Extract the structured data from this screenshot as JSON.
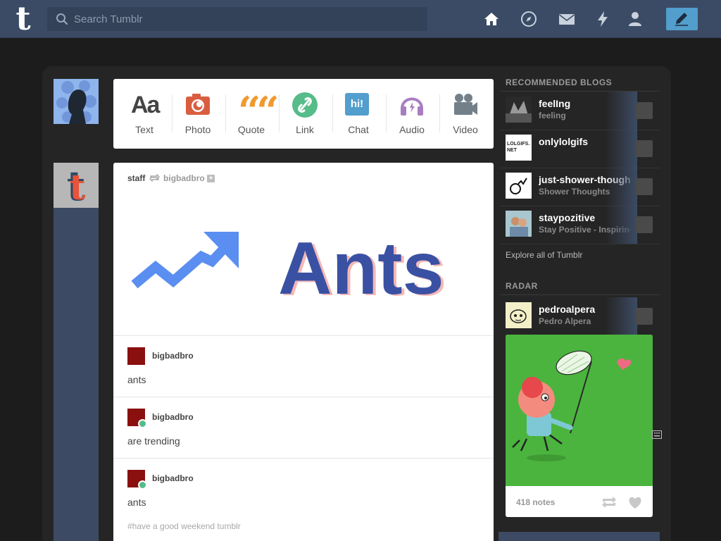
{
  "header": {
    "logo": "t",
    "search_placeholder": "Search Tumblr",
    "nav_icons": [
      "home-icon",
      "explore-compass-icon",
      "inbox-envelope-icon",
      "activity-lightning-icon",
      "account-person-icon",
      "compose-pencil-icon"
    ]
  },
  "post_types": [
    {
      "label": "Text",
      "glyph": "Aa",
      "color": "#444444"
    },
    {
      "label": "Photo",
      "color": "#d95e40"
    },
    {
      "label": "Quote",
      "glyph": "““",
      "color": "#f2992e"
    },
    {
      "label": "Link",
      "color": "#56bc8a"
    },
    {
      "label": "Chat",
      "glyph": "hi!",
      "color": "#529ecc"
    },
    {
      "label": "Audio",
      "color": "#a77dc2"
    },
    {
      "label": "Video",
      "color": "#748089"
    }
  ],
  "post": {
    "author": "staff",
    "reblogged_from": "bigbadbro",
    "image_text": "Ants",
    "thread": [
      {
        "name": "bigbadbro",
        "text": "ants",
        "reblog": false
      },
      {
        "name": "bigbadbro",
        "text": "are trending",
        "reblog": true
      },
      {
        "name": "bigbadbro",
        "text": "ants",
        "reblog": true
      }
    ],
    "tags": "#have a good weekend tumblr"
  },
  "sidebar": {
    "recommended_title": "RECOMMENDED BLOGS",
    "blogs": [
      {
        "name": "feelIng",
        "sub": "feeling"
      },
      {
        "name": "onlylolgifs",
        "sub": "",
        "avatar_text": "LOLGIFS.\nNET"
      },
      {
        "name": "just-shower-thoughts",
        "sub": "Shower Thoughts"
      },
      {
        "name": "staypozitive",
        "sub": "Stay Positive - Inspiring"
      }
    ],
    "explore": "Explore all of Tumblr",
    "radar_title": "RADAR",
    "radar": {
      "name": "pedroalpera",
      "sub": "Pedro Alpera",
      "notes": "418 notes"
    }
  },
  "colors": {
    "header": "#3b4b66",
    "accent": "#529ecc",
    "radar_green": "#4bb43e"
  }
}
